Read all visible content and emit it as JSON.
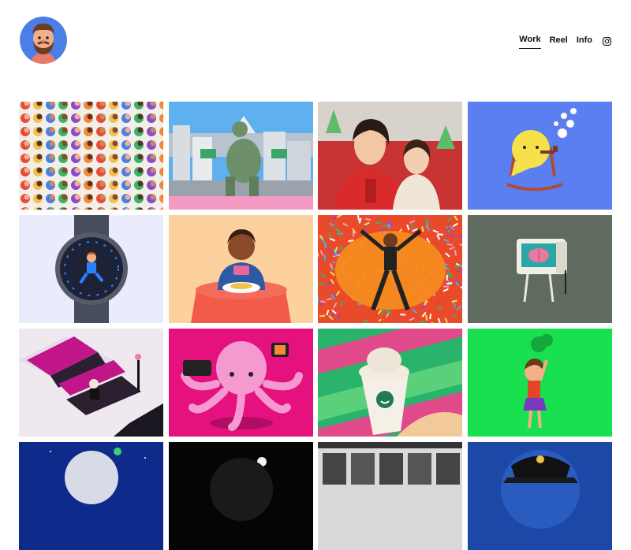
{
  "site": {
    "logo_icon": "bearded-man-avatar-icon",
    "accent": "#4a7ee8"
  },
  "nav": {
    "items": [
      {
        "label": "Work",
        "active": true
      },
      {
        "label": "Reel",
        "active": false
      },
      {
        "label": "Info",
        "active": false
      }
    ],
    "social_icon": "instagram-icon"
  },
  "projects": [
    {
      "name": "crowd-of-characters",
      "bg": "#f2efe9"
    },
    {
      "name": "city-giant-walking",
      "bg": "#5aa8ea"
    },
    {
      "name": "mother-child-holiday-photo",
      "bg": "#c93434"
    },
    {
      "name": "yellow-blob-rocking-chair",
      "bg": "#5b7ff0"
    },
    {
      "name": "smartwatch-runner",
      "bg": "#eaecfb"
    },
    {
      "name": "girl-eating-table",
      "bg": "#fcd19e"
    },
    {
      "name": "snow-angel-confetti",
      "bg": "#f07a1e"
    },
    {
      "name": "retro-computer-brain",
      "bg": "#5e6b5e"
    },
    {
      "name": "vampire-coffins",
      "bg": "#efe9ef"
    },
    {
      "name": "pink-octopus-phones",
      "bg": "#e5117e"
    },
    {
      "name": "drink-cup-smile",
      "bg": "#2ab36a"
    },
    {
      "name": "girl-green-background",
      "bg": "#18e04e"
    },
    {
      "name": "moon-night-sky",
      "bg": "#0e2a8a"
    },
    {
      "name": "dark-moon",
      "bg": "#050505"
    },
    {
      "name": "gallery-wall",
      "bg": "#d9d9d9"
    },
    {
      "name": "captain-hat-blue",
      "bg": "#1c49a8"
    }
  ]
}
